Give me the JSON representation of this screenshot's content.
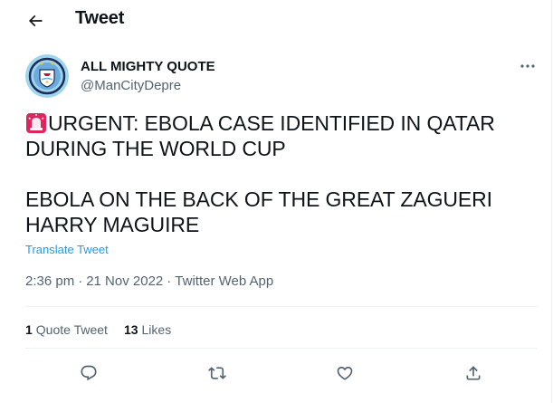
{
  "header": {
    "title": "Tweet",
    "back_icon": "arrow-left-icon"
  },
  "author": {
    "name": "ALL MIGHTY QUOTE",
    "handle": "@ManCityDepre",
    "avatar": "man-city-crest-avatar"
  },
  "tweet": {
    "lines": [
      "URGENT: EBOLA CASE IDENTIFIED IN QATAR",
      "DURING THE WORLD CUP",
      " EBOLA ON THE BACK OF THE GREAT ZAGUERI",
      "HARRY MAGUIRE"
    ],
    "emoji": "rotating-light-emoji",
    "translate_label": "Translate Tweet"
  },
  "meta": {
    "time": "2:36 pm",
    "date": "21 Nov 2022",
    "source": "Twitter Web App",
    "separator": "·"
  },
  "stats": {
    "quote_count": "1",
    "quote_label": "Quote Tweet",
    "likes_count": "13",
    "likes_label": "Likes"
  },
  "actions": [
    "reply-icon",
    "retweet-icon",
    "like-icon",
    "share-icon"
  ],
  "colors": {
    "accent": "#1d9bf0",
    "secondary_text": "#536471",
    "border": "#eff3f4",
    "text": "#0f1419"
  }
}
